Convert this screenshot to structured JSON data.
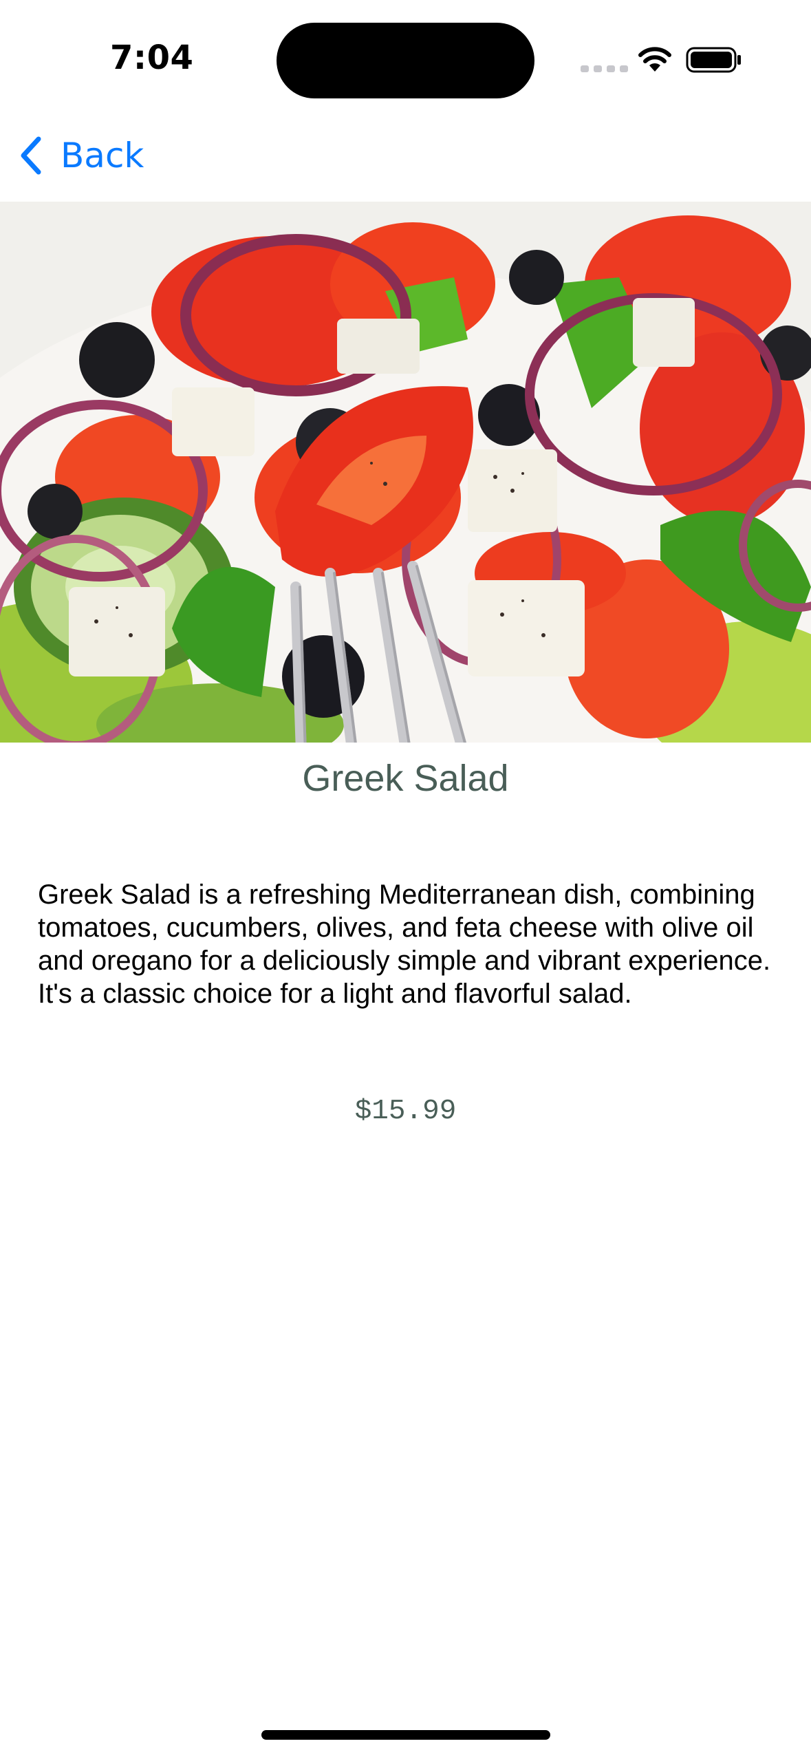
{
  "status_bar": {
    "time": "7:04"
  },
  "nav": {
    "back_label": "Back"
  },
  "hero": {
    "icon": "greek-salad-photo"
  },
  "dish": {
    "title": "Greek Salad",
    "description": "Greek Salad is a refreshing Mediterranean dish, combining tomatoes, cucumbers, olives, and feta cheese with olive oil and oregano for a deliciously simple and vibrant experience. It's a classic choice for a light and flavorful salad.",
    "price": "$15.99"
  },
  "colors": {
    "accent_blue": "#0a7aff",
    "title_green": "#495e57"
  }
}
